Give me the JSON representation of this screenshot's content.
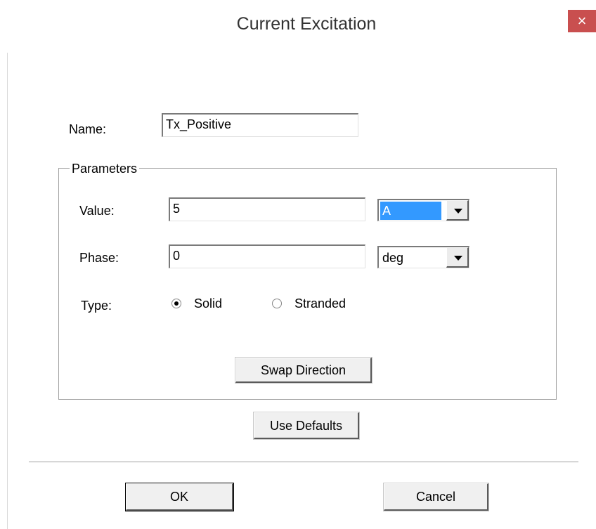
{
  "window": {
    "title": "Current Excitation",
    "close_symbol": "×"
  },
  "fields": {
    "name": {
      "label": "Name:",
      "value": "Tx_Positive"
    }
  },
  "parameters": {
    "title": "Parameters",
    "value": {
      "label": "Value:",
      "value": "5",
      "unit": "A"
    },
    "phase": {
      "label": "Phase:",
      "value": "0",
      "unit": "deg"
    },
    "type": {
      "label": "Type:",
      "options": [
        "Solid",
        "Stranded"
      ],
      "selected": "Solid"
    },
    "swap_label": "Swap Direction"
  },
  "buttons": {
    "use_defaults": "Use Defaults",
    "ok": "OK",
    "cancel": "Cancel"
  },
  "colors": {
    "close_button": "#c94f4f",
    "selection": "#3399ff"
  }
}
